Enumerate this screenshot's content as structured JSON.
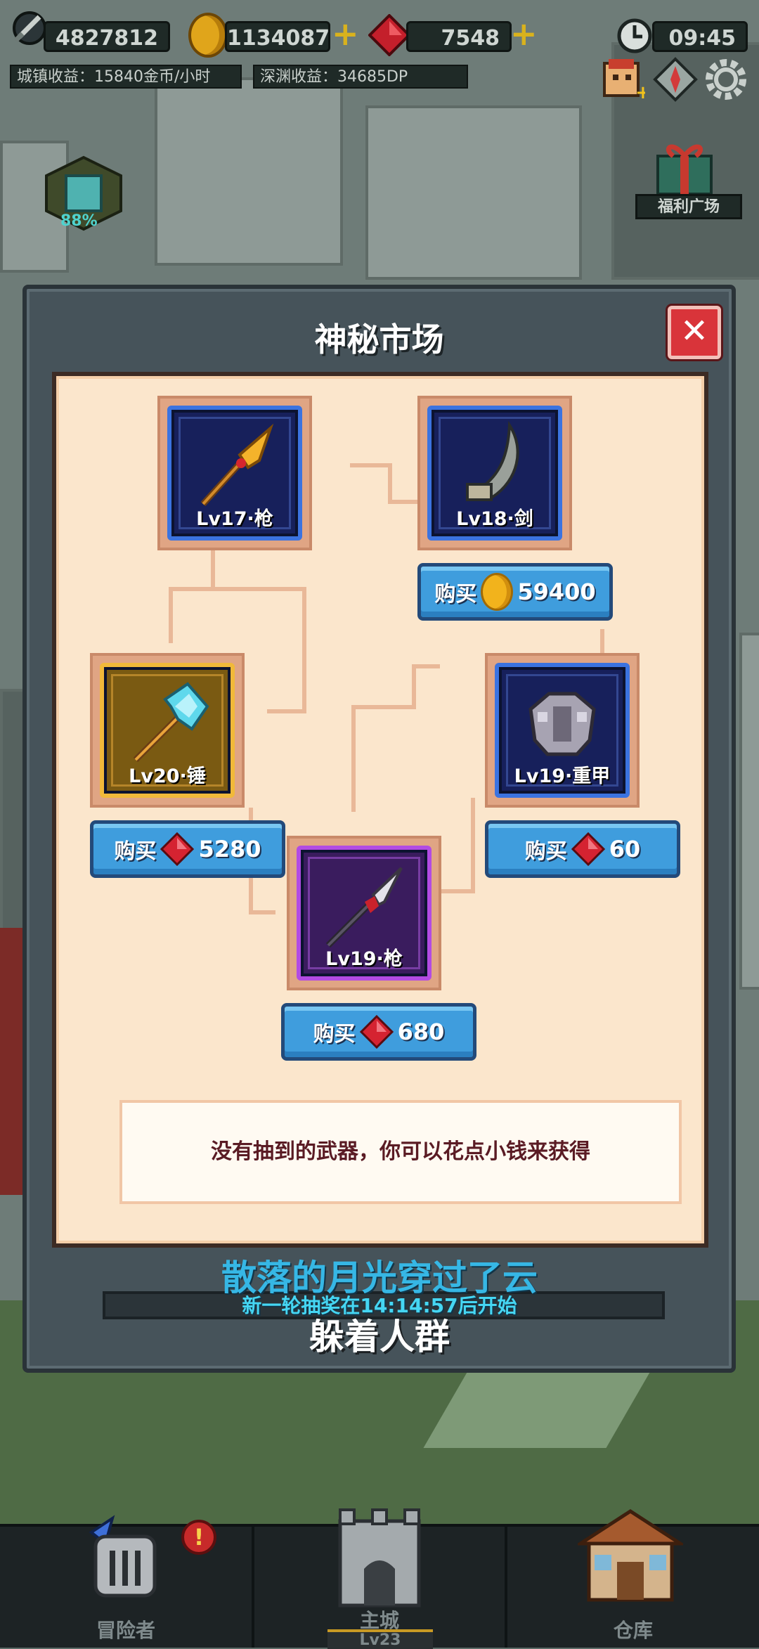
{
  "hud": {
    "power": "4827812",
    "coins": "1134087",
    "gems": "7548",
    "time": "09:45",
    "town_income": "城镇收益：15840金币/小时",
    "abyss_income": "深渊收益：34685DP",
    "building_progress": "88%",
    "welfare_label": "福利广场"
  },
  "market": {
    "title": "神秘市场",
    "close_icon": "close-icon",
    "items": [
      {
        "label": "Lv17·枪",
        "rarity": "blue",
        "icon": "golden-spear-icon",
        "purchasable": false
      },
      {
        "label": "Lv18·剑",
        "rarity": "blue",
        "icon": "curved-blade-icon",
        "purchasable": true,
        "buy_label": "购买",
        "currency": "coin",
        "price": "59400"
      },
      {
        "label": "Lv20·锤",
        "rarity": "gold",
        "icon": "ice-axe-icon",
        "purchasable": true,
        "buy_label": "购买",
        "currency": "gem",
        "price": "5280"
      },
      {
        "label": "Lv19·重甲",
        "rarity": "blue",
        "icon": "heavy-armor-icon",
        "purchasable": true,
        "buy_label": "购买",
        "currency": "gem",
        "price": "60"
      },
      {
        "label": "Lv19·枪",
        "rarity": "purple",
        "icon": "red-spear-icon",
        "purchasable": true,
        "buy_label": "购买",
        "currency": "gem",
        "price": "680"
      }
    ],
    "hint": "没有抽到的武器，你可以花点小钱来获得",
    "countdown": "新一轮抽奖在14:14:57后开始"
  },
  "overlay": {
    "lyric_line1": "散落的月光穿过了云",
    "lyric_line2": "躲着人群"
  },
  "nav": {
    "adventurer": "冒险者",
    "main_city": "主城",
    "main_city_level": "Lv23",
    "warehouse": "仓库",
    "alert": "!"
  }
}
